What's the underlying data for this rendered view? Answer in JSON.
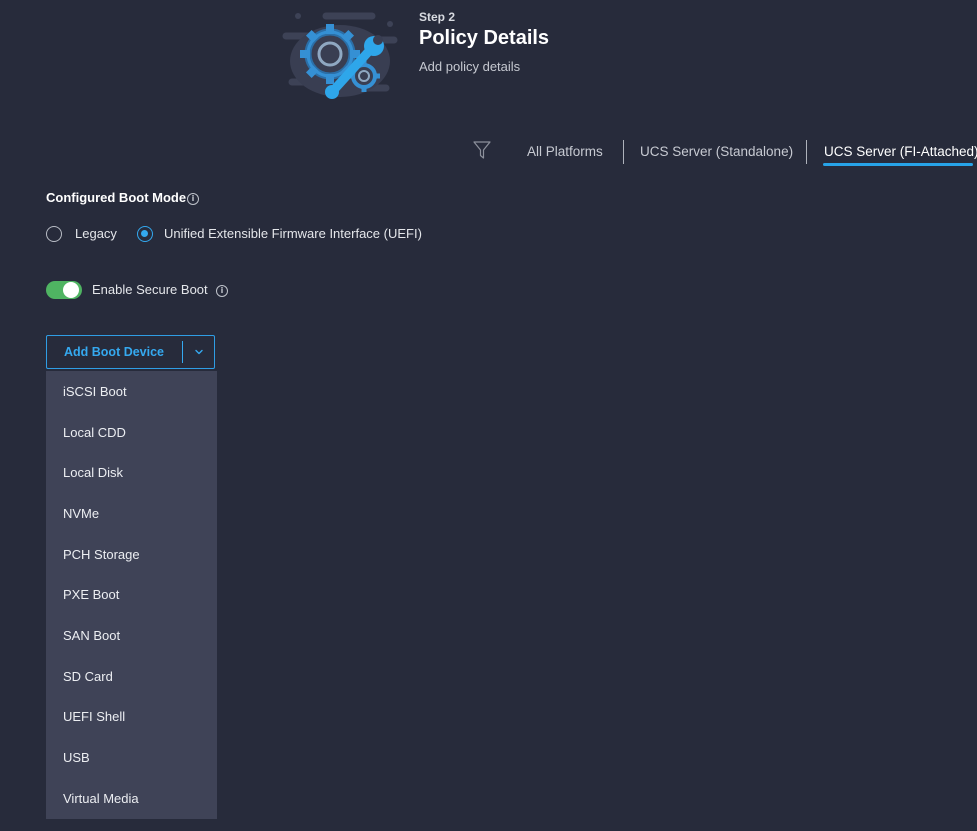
{
  "header": {
    "step": "Step 2",
    "title": "Policy Details",
    "subtitle": "Add policy details"
  },
  "platform_tabs": [
    {
      "label": "All Platforms",
      "active": false
    },
    {
      "label": "UCS Server (Standalone)",
      "active": false
    },
    {
      "label": "UCS Server (FI-Attached)",
      "active": true
    }
  ],
  "boot_mode": {
    "heading": "Configured Boot Mode",
    "options": [
      {
        "label": "Legacy",
        "selected": false
      },
      {
        "label": "Unified Extensible Firmware Interface (UEFI)",
        "selected": true
      }
    ]
  },
  "secure_boot": {
    "label": "Enable Secure Boot",
    "enabled": true
  },
  "add_boot_device": {
    "label": "Add Boot Device",
    "menu_open": true,
    "items": [
      "iSCSI Boot",
      "Local CDD",
      "Local Disk",
      "NVMe",
      "PCH Storage",
      "PXE Boot",
      "SAN Boot",
      "SD Card",
      "UEFI Shell",
      "USB",
      "Virtual Media"
    ]
  },
  "icons": {
    "hero": "gear-wrench-icon",
    "filter": "filter-icon",
    "info": "info-icon",
    "caret": "chevron-down-icon"
  },
  "colors": {
    "background": "#272b3b",
    "accent": "#33a8ee",
    "toggle_on": "#4fb462",
    "menu_bg": "#3f4357"
  }
}
